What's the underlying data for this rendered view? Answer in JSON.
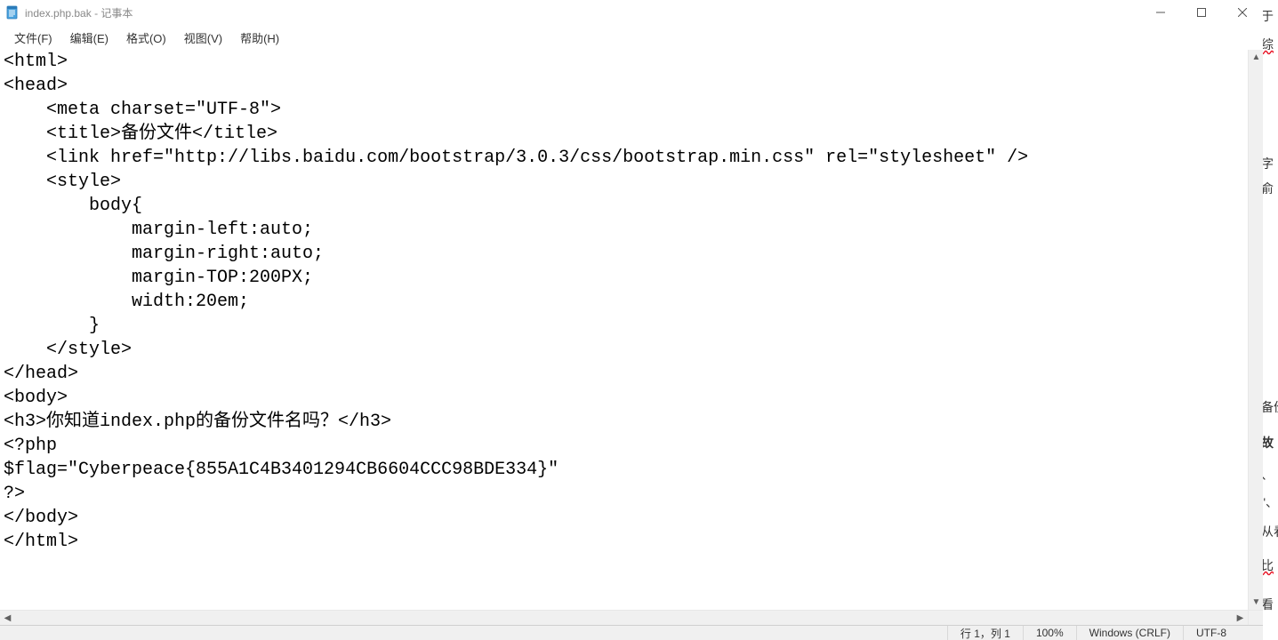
{
  "titlebar": {
    "filename": "index.php.bak",
    "appname": "记事本",
    "separator": " - "
  },
  "menubar": {
    "file": "文件(F)",
    "edit": "编辑(E)",
    "format": "格式(O)",
    "view": "视图(V)",
    "help": "帮助(H)"
  },
  "editor": {
    "lines": [
      "<html>",
      "<head>",
      "    <meta charset=\"UTF-8\">",
      "    <title>备份文件</title>",
      "    <link href=\"http://libs.baidu.com/bootstrap/3.0.3/css/bootstrap.min.css\" rel=\"stylesheet\" />",
      "    <style>",
      "        body{",
      "            margin-left:auto;",
      "            margin-right:auto;",
      "            margin-TOP:200PX;",
      "            width:20em;",
      "        }",
      "    </style>",
      "</head>",
      "<body>",
      "<h3>你知道index.php的备份文件名吗？</h3>",
      "<?php",
      "$flag=\"Cyberpeace{855A1C4B3401294CB6604CCC98BDE334}\"",
      "?>",
      "</body>",
      "</html>"
    ]
  },
  "statusbar": {
    "position": "行 1，列 1",
    "zoom": "100%",
    "line_ending": "Windows (CRLF)",
    "encoding": "UTF-8"
  },
  "side_fragments": {
    "f1": "于",
    "f2": "综",
    "f3": "字",
    "f4": "俞",
    "f5": "备份",
    "f6": "故",
    "f7": "、",
    "f8": "\"、",
    "f9": "从看",
    "f10": "比",
    "f11": "看"
  }
}
